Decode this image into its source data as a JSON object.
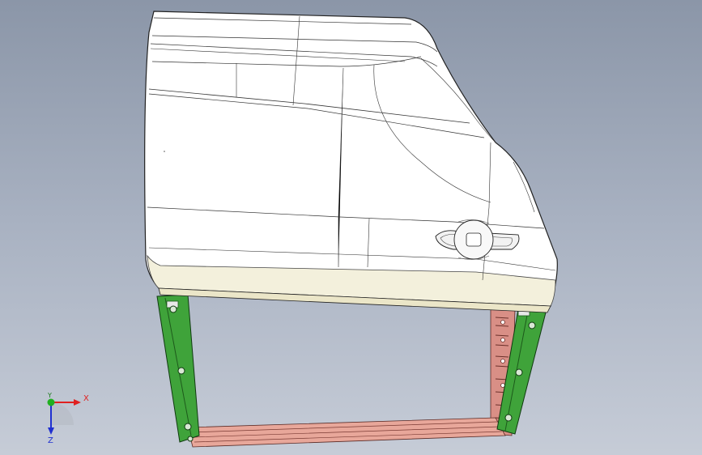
{
  "viewport": {
    "background_top": "#8b96a8",
    "background_bottom": "#c6ccd7"
  },
  "model": {
    "panel_fill": "#ffffff",
    "panel_lower_fill": "#f3f0dc",
    "edge_color": "#222222",
    "left_bracket_color": "#3fa33a",
    "right_bracket_color": "#3fa33a",
    "bottom_rail_color": "#e8a79a",
    "right_rail_color": "#d98f86",
    "handle_icon": "door-handle-icon"
  },
  "triad": {
    "x_label": "X",
    "y_label": "Y",
    "z_label": "Z",
    "x_color": "#e02020",
    "y_color": "#20b020",
    "z_color": "#2030d0"
  }
}
